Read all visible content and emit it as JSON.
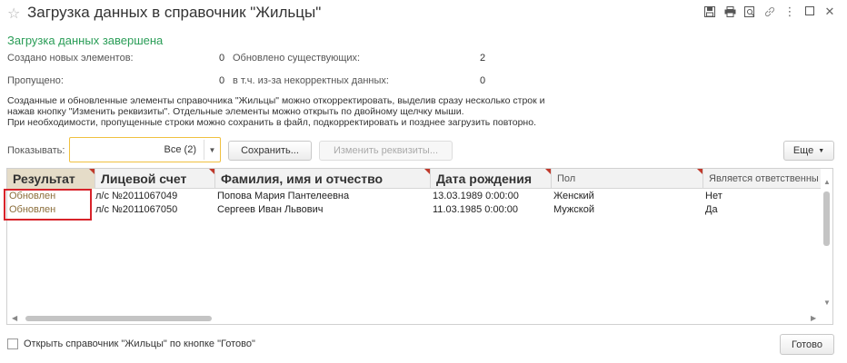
{
  "window": {
    "title": "Загрузка данных в справочник \"Жильцы\"",
    "icons": [
      "save-icon",
      "print-icon",
      "preview-icon",
      "link-icon",
      "more-icon",
      "maximize-icon",
      "close-icon"
    ]
  },
  "status": "Загрузка данных завершена",
  "stats": {
    "created_label": "Создано новых элементов:",
    "created_value": "0",
    "updated_label": "Обновлено существующих:",
    "updated_value": "2",
    "skipped_label": "Пропущено:",
    "skipped_value": "0",
    "incorrect_label": "в т.ч. из-за некорректных данных:",
    "incorrect_value": "0"
  },
  "note": {
    "line1": "Созданные и обновленные элементы справочника \"Жильцы\" можно откорректировать, выделив сразу несколько строк и",
    "line2": "нажав кнопку \"Изменить реквизиты\". Отдельные элементы можно открыть по двойному щелчку мыши.",
    "line3": "При необходимости, пропущенные строки можно сохранить в файл, подкорректировать и позднее загрузить повторно."
  },
  "toolbar": {
    "show_label": "Показывать:",
    "show_value": "Все (2)",
    "save_label": "Сохранить...",
    "edit_label": "Изменить реквизиты...",
    "more_label": "Еще"
  },
  "table": {
    "columns": [
      "Результат",
      "Лицевой счет",
      "Фамилия, имя и отчество",
      "Дата рождения",
      "Пол",
      "Является ответственны"
    ],
    "rows": [
      {
        "result": "Обновлен",
        "account": "л/с №2011067049",
        "name": "Попова Мария Пантелеевна",
        "birth": "13.03.1989 0:00:00",
        "gender": "Женский",
        "responsible": "Нет"
      },
      {
        "result": "Обновлен",
        "account": "л/с №2011067050",
        "name": "Сергеев Иван Львович",
        "birth": "11.03.1985 0:00:00",
        "gender": "Мужской",
        "responsible": "Да"
      }
    ]
  },
  "footer": {
    "checkbox_label": "Открыть справочник \"Жильцы\" по кнопке \"Готово\"",
    "checkbox_checked": false,
    "done_label": "Готово"
  },
  "colors": {
    "status_green": "#2a9d57",
    "highlight_red": "#d8232a",
    "result_text": "#8b6e3b",
    "field_border_yellow": "#f0c040"
  }
}
